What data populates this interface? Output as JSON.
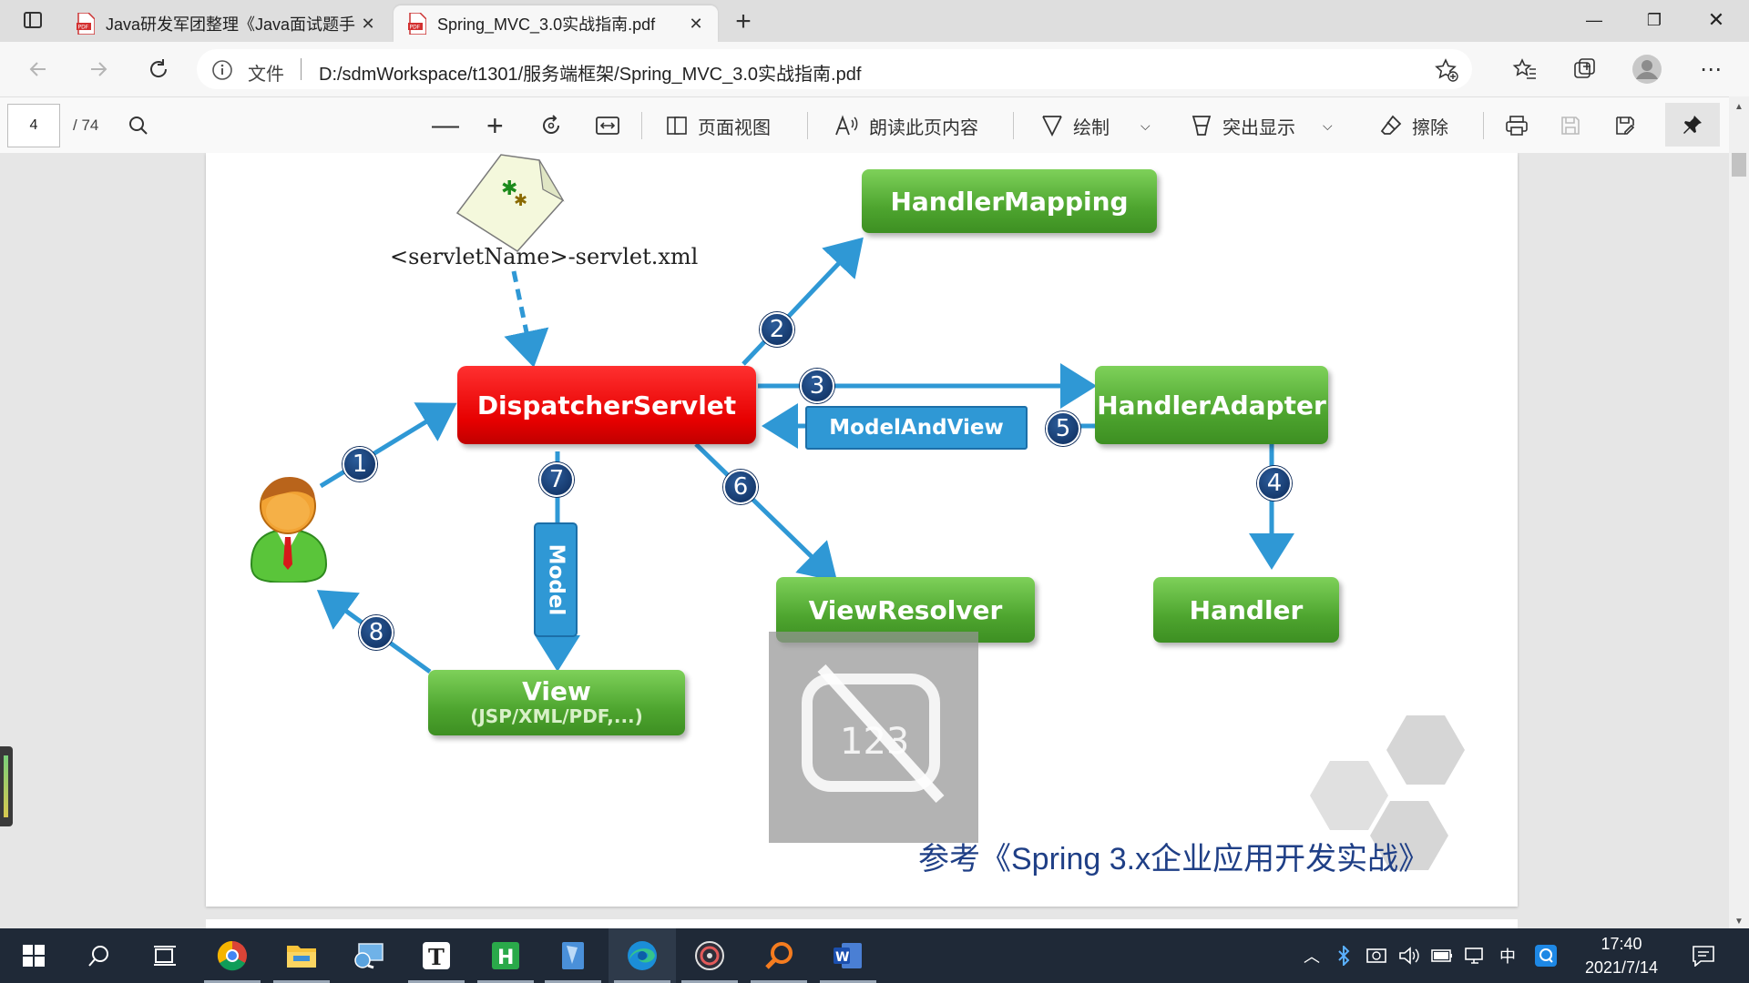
{
  "browser": {
    "tabs": [
      {
        "title": "Java研发军团整理《Java面试题手",
        "active": false
      },
      {
        "title": "Spring_MVC_3.0实战指南.pdf",
        "active": true
      }
    ],
    "new_tab_label": "+",
    "address": {
      "scheme_label": "文件",
      "url": "D:/sdmWorkspace/t1301/服务端框架/Spring_MVC_3.0实战指南.pdf"
    }
  },
  "pdf_toolbar": {
    "page_number": "4",
    "page_total": "/ 74",
    "page_view_label": "页面视图",
    "read_aloud_label": "朗读此页内容",
    "draw_label": "绘制",
    "highlight_label": "突出显示",
    "erase_label": "擦除"
  },
  "diagram": {
    "config_file_label": "<servletName>-servlet.xml",
    "dispatcher": "DispatcherServlet",
    "handler_mapping": "HandlerMapping",
    "handler_adapter": "HandlerAdapter",
    "model_and_view": "ModelAndView",
    "view_resolver": "ViewResolver",
    "handler": "Handler",
    "model": "Model",
    "view_title": "View",
    "view_subtitle": "(JSP/XML/PDF,...)",
    "steps": [
      "1",
      "2",
      "3",
      "4",
      "5",
      "6",
      "7",
      "8"
    ],
    "overlay_text": "123",
    "reference": "参考《Spring 3.x企业应用开发实战》"
  },
  "taskbar": {
    "time": "17:40",
    "date": "2021/7/14",
    "ime": "中",
    "apps": [
      "windows-start",
      "search",
      "task-view",
      "chrome",
      "file-explorer",
      "remote-desktop",
      "typora",
      "hbuilder",
      "notepad",
      "edge",
      "music",
      "search-tool",
      "word"
    ]
  },
  "colors": {
    "green_box": "#5cb83a",
    "red_box": "#e60000",
    "arrow_blue": "#2f98d5",
    "step_navy": "#0d2b5a",
    "reference_text": "#1f3f86"
  }
}
